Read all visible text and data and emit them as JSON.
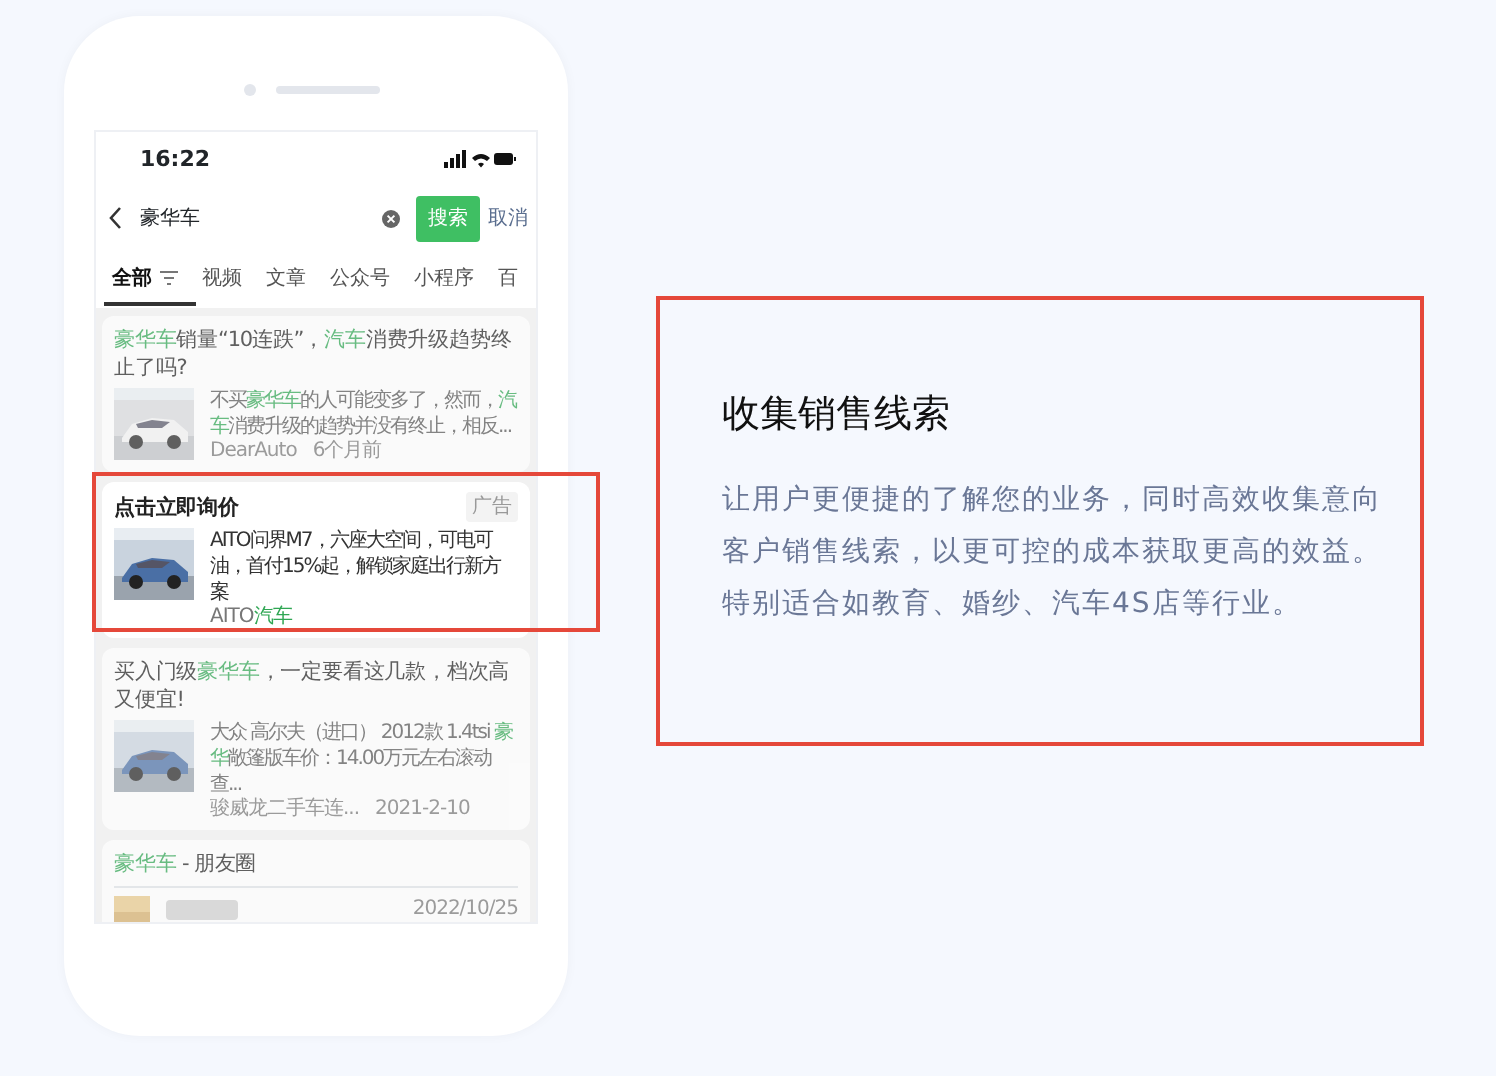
{
  "phone": {
    "status_bar": {
      "time": "16:22"
    },
    "search": {
      "value": "豪华车",
      "button": "搜索",
      "cancel": "取消"
    },
    "tabs": [
      {
        "label": "全部",
        "selected": true
      },
      {
        "label": "视频",
        "selected": false
      },
      {
        "label": "文章",
        "selected": false
      },
      {
        "label": "公众号",
        "selected": false
      },
      {
        "label": "小程序",
        "selected": false
      },
      {
        "label": "百",
        "selected": false
      }
    ],
    "results": [
      {
        "kind": "article",
        "dimmed": true,
        "title": [
          {
            "text": "豪华车",
            "hl": true
          },
          {
            "text": "销量“10连跌”，",
            "hl": false
          },
          {
            "text": "汽车",
            "hl": true
          },
          {
            "text": "消费升级趋势终止了吗?",
            "hl": false
          }
        ],
        "snippet": [
          {
            "text": "不买",
            "hl": false
          },
          {
            "text": "豪华车",
            "hl": true
          },
          {
            "text": "的人可能变多了，然而，",
            "hl": false
          },
          {
            "text": "汽车",
            "hl": true
          },
          {
            "text": "消费升级的趋势并没有终止，相反...",
            "hl": false
          }
        ],
        "meta": [
          "DearAuto",
          "6个月前"
        ]
      },
      {
        "kind": "ad",
        "dimmed": false,
        "title": [
          {
            "text": "点击立即询价",
            "hl": false
          }
        ],
        "ad_label": "广告",
        "snippet": [
          {
            "text": "AITO问界M7，六座大空间，可电可油，首付15%起，解锁家庭出行新方案",
            "hl": false
          }
        ],
        "source": [
          {
            "text": "AITO",
            "hl": false
          },
          {
            "text": "汽车",
            "hl": true
          }
        ]
      },
      {
        "kind": "article",
        "dimmed": true,
        "title": [
          {
            "text": "买入门级",
            "hl": false
          },
          {
            "text": "豪华车",
            "hl": true
          },
          {
            "text": "，一定要看这几款，档次高又便宜!",
            "hl": false
          }
        ],
        "snippet": [
          {
            "text": "大众 高尔夫（进口） 2012款 1.4tsi ",
            "hl": false
          },
          {
            "text": "豪华",
            "hl": true
          },
          {
            "text": "敞篷版车价：14.00万元左右滚动查...",
            "hl": false
          }
        ],
        "meta": [
          "骏威龙二手车连...",
          "2021-2-10"
        ]
      },
      {
        "kind": "moments",
        "dimmed": true,
        "title": [
          {
            "text": "豪华车",
            "hl": true
          },
          {
            "text": " - 朋友圈",
            "hl": false
          }
        ],
        "date": "2022/10/25"
      }
    ]
  },
  "feature": {
    "title": "收集销售线索",
    "description": "让用户更便捷的了解您的业务，同时高效收集意向客户销售线索，以更可控的成本获取更高的效益。特别适合如教育、婚纱、汽车4S店等行业。"
  }
}
